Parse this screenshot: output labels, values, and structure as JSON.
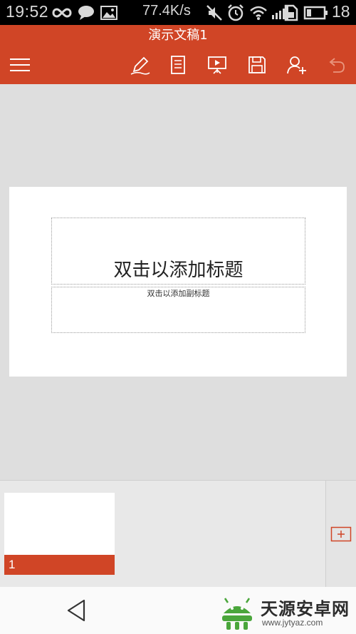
{
  "status_bar": {
    "time": "19:52",
    "net_speed": "77.4K/s",
    "battery_level": "18",
    "icons": [
      "infinity-icon",
      "chat-bubble-icon",
      "image-icon",
      "mute-icon",
      "alarm-icon",
      "wifi-icon",
      "signal-icon",
      "sim-icon",
      "battery-icon"
    ]
  },
  "app": {
    "title": "演示文稿1",
    "accent_color": "#d04526",
    "toolbar": [
      "menu-icon",
      "pen-edit-icon",
      "notes-icon",
      "present-icon",
      "save-icon",
      "share-user-icon",
      "undo-icon"
    ]
  },
  "slide": {
    "title_placeholder": "双击以添加标题",
    "subtitle_placeholder": "双击以添加副标题"
  },
  "thumbnails": [
    {
      "number": "1",
      "selected": true
    }
  ],
  "watermark": {
    "name": "天源安卓网",
    "url": "www.jytyaz.com"
  }
}
